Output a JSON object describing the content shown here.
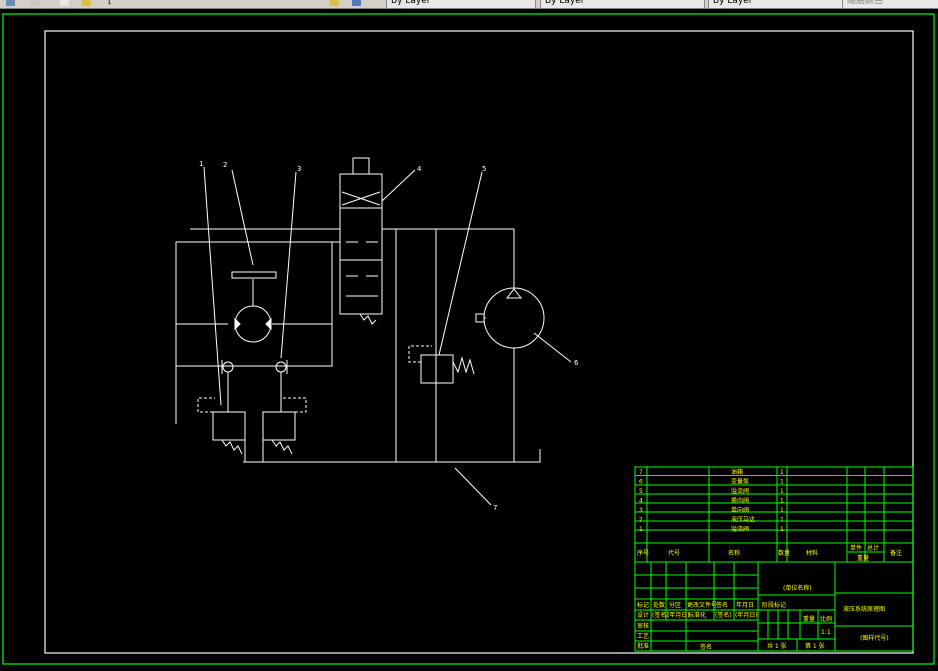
{
  "toolbar": {
    "bracket_text": "[",
    "tabs": [
      "By Layer",
      "By Layer",
      "By Layer"
    ],
    "partial_label": "随层颜色"
  },
  "balloons": [
    "1",
    "2",
    "3",
    "4",
    "5",
    "6",
    "7"
  ],
  "parts_list": {
    "rows": [
      {
        "no": "7",
        "name": "油箱",
        "qty": "1"
      },
      {
        "no": "6",
        "name": "变量泵",
        "qty": "1"
      },
      {
        "no": "5",
        "name": "溢流阀",
        "qty": "1"
      },
      {
        "no": "4",
        "name": "换向阀",
        "qty": "1"
      },
      {
        "no": "3",
        "name": "单向阀",
        "qty": "1"
      },
      {
        "no": "2",
        "name": "液压马达",
        "qty": "1"
      },
      {
        "no": "1",
        "name": "溢流阀",
        "qty": "1"
      }
    ],
    "header": {
      "no": "序号",
      "code": "代号",
      "name": "名称",
      "qty": "数量",
      "material": "材料",
      "unit_weight": "单件",
      "total_weight": "总计",
      "weight": "重量",
      "remark": "备注"
    }
  },
  "title_block": {
    "unit_name": "(单位名称)",
    "drawing_title": "液压系统原理图",
    "drawing_code": "(图样代号)",
    "sign_row1": [
      "标记",
      "处数",
      "分区",
      "更改文件号",
      "签名",
      "年月日"
    ],
    "sign_row2": [
      "设计",
      "(签名)",
      "(年月日)",
      "标准化",
      "(签名)",
      "(年月日)"
    ],
    "roles": [
      "审核",
      "工艺",
      "批准"
    ],
    "stage_label": "阶段标记",
    "weight_label": "重量",
    "scale_label": "比例",
    "scale_value": "1:1",
    "sheets": "共 1 张",
    "sheet_no": "第 1 张"
  },
  "colors": {
    "background": "#000000",
    "border": "#ffffff",
    "outer_border": "#00ff00",
    "table_lines": "#00ff00",
    "table_text": "#ffff00",
    "schematic": "#ffffff"
  }
}
